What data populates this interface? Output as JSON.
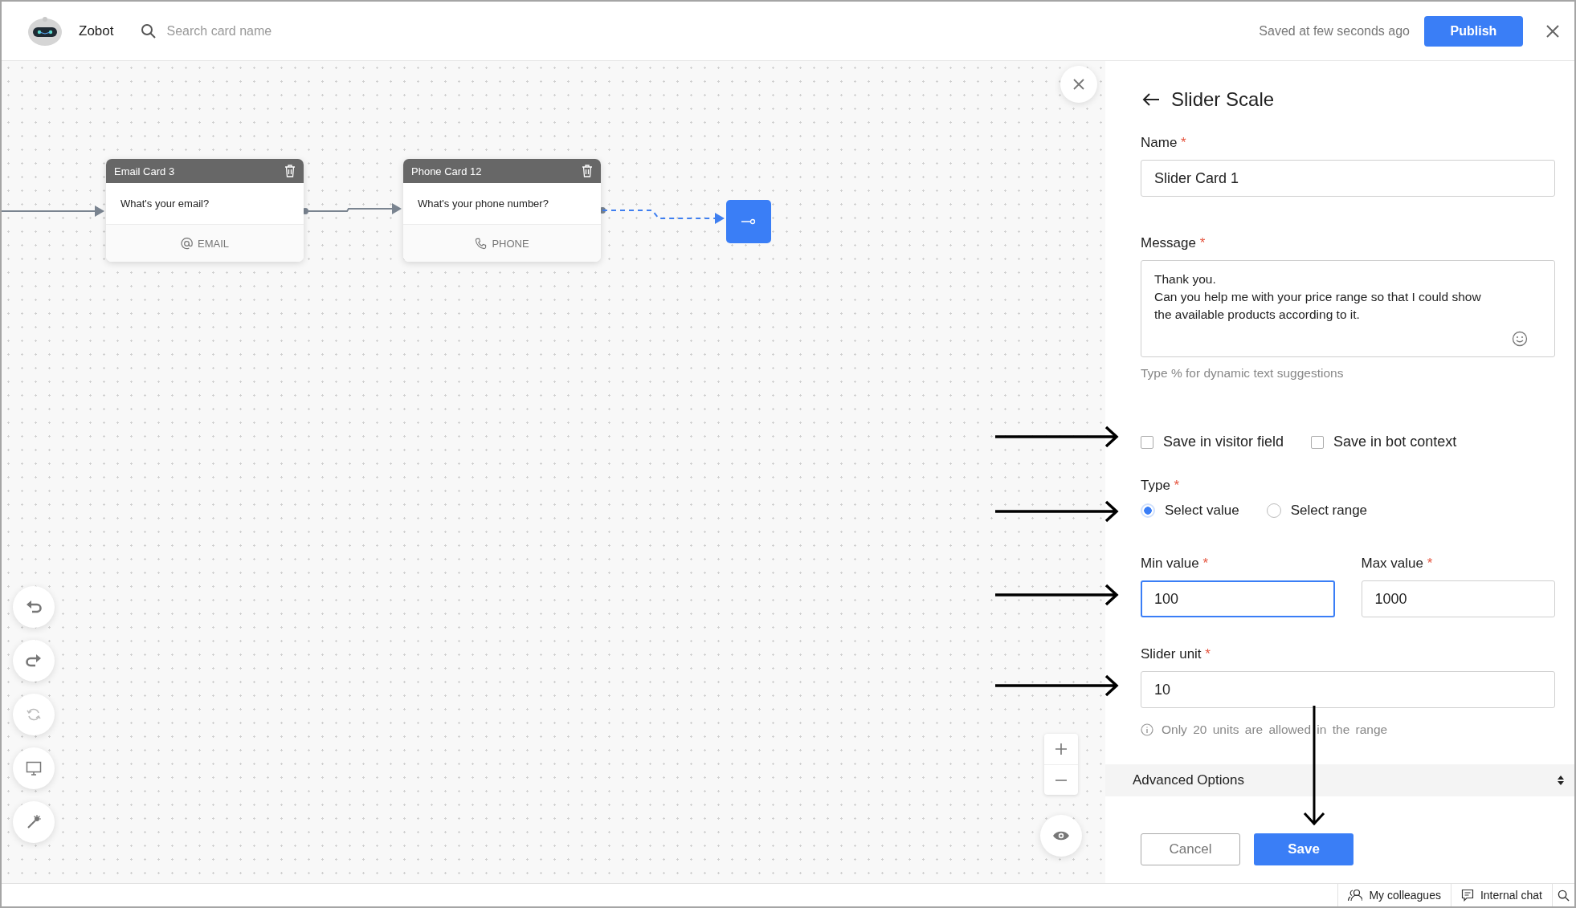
{
  "header": {
    "app_name": "Zobot",
    "search": {
      "placeholder": "Search card name"
    },
    "save_status": "Saved at few seconds ago",
    "publish_button": "Publish"
  },
  "canvas": {
    "cards": [
      {
        "title": "Email Card 3",
        "question": "What's your email?",
        "kind": "email",
        "footer": "EMAIL"
      },
      {
        "title": "Phone Card 12",
        "question": "What's your phone number?",
        "kind": "phone",
        "footer": "PHONE"
      }
    ]
  },
  "panel": {
    "title": "Slider Scale",
    "name": {
      "label": "Name",
      "required_mark": "*",
      "value": "Slider Card 1"
    },
    "message": {
      "label": "Message",
      "required_mark": "*",
      "value": "Thank you.\nCan you help me with your price range so that I could show\nthe available products according to it.",
      "hint": "Type % for dynamic text suggestions"
    },
    "checkboxes": [
      {
        "label": "Save in visitor field",
        "checked": false
      },
      {
        "label": "Save in bot context",
        "checked": false
      }
    ],
    "type": {
      "label": "Type",
      "required_mark": "*",
      "options": [
        {
          "label": "Select value",
          "selected": true
        },
        {
          "label": "Select range",
          "selected": false
        }
      ]
    },
    "min": {
      "label": "Min value",
      "required_mark": "*",
      "value": "100",
      "focused": true
    },
    "max": {
      "label": "Max value",
      "required_mark": "*",
      "value": "1000",
      "focused": false
    },
    "unit": {
      "label": "Slider unit",
      "required_mark": "*",
      "value": "10",
      "focused": false,
      "info": "Only 20 units are allowed in the range"
    },
    "advanced": "Advanced Options",
    "buttons": {
      "cancel": "Cancel",
      "save": "Save"
    }
  },
  "status_bar": {
    "items": [
      {
        "label": "My colleagues",
        "kind": "people"
      },
      {
        "label": "Internal chat",
        "kind": "chat"
      }
    ]
  }
}
